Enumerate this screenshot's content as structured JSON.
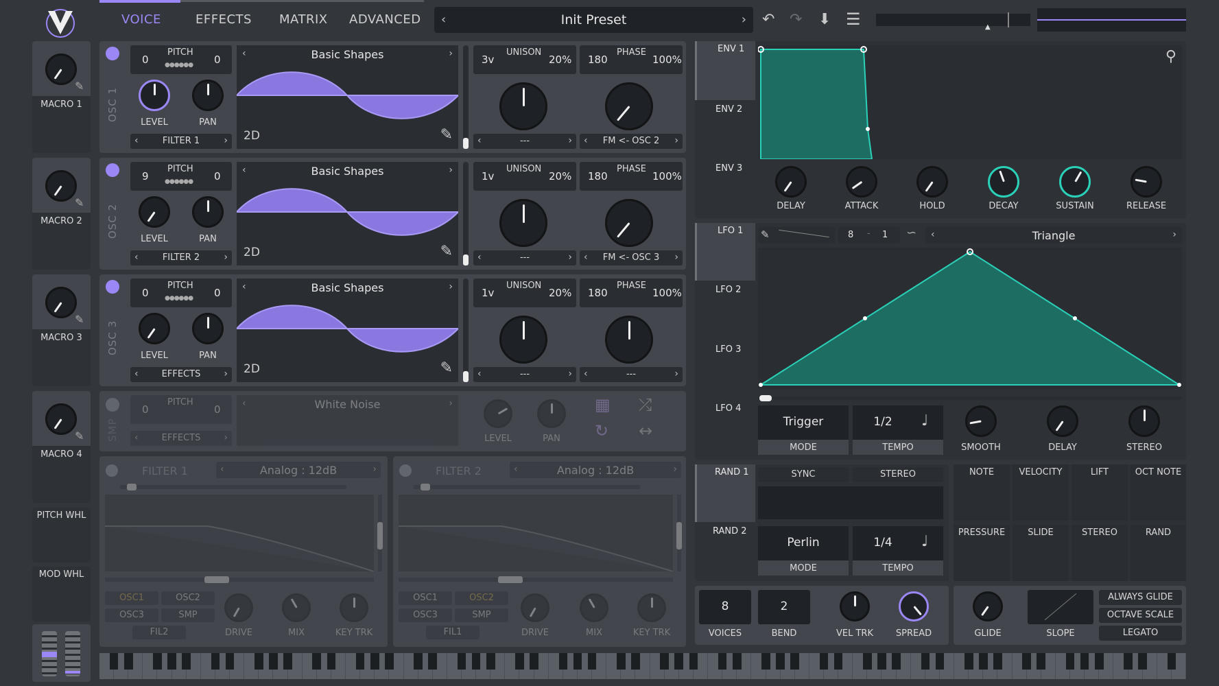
{
  "nav": {
    "tabs": [
      "VOICE",
      "EFFECTS",
      "MATRIX",
      "ADVANCED"
    ],
    "active": "VOICE"
  },
  "preset": {
    "name": "Init Preset"
  },
  "colors": {
    "accent": "#9b87f5",
    "teal": "#2ad1b8",
    "bg": "#33373c"
  },
  "macros": [
    {
      "label": "MACRO 1"
    },
    {
      "label": "MACRO 2"
    },
    {
      "label": "MACRO 3"
    },
    {
      "label": "MACRO 4"
    }
  ],
  "wheels": {
    "pitch": "PITCH WHL",
    "mod": "MOD WHL"
  },
  "osc": [
    {
      "name": "OSC 1",
      "pitch_left": "0",
      "pitch_right": "0",
      "pitch_label": "PITCH",
      "level": "LEVEL",
      "pan": "PAN",
      "dest": "FILTER 1",
      "wave": "Basic Shapes",
      "mode": "2D",
      "unison_v": "3v",
      "unison_label": "UNISON",
      "unison_pct": "20%",
      "phase_val": "180",
      "phase_label": "PHASE",
      "phase_pct": "100%",
      "unison_dest": "---",
      "phase_dest": "FM <- OSC 2"
    },
    {
      "name": "OSC 2",
      "pitch_left": "9",
      "pitch_right": "0",
      "pitch_label": "PITCH",
      "level": "LEVEL",
      "pan": "PAN",
      "dest": "FILTER 2",
      "wave": "Basic Shapes",
      "mode": "2D",
      "unison_v": "1v",
      "unison_label": "UNISON",
      "unison_pct": "20%",
      "phase_val": "180",
      "phase_label": "PHASE",
      "phase_pct": "100%",
      "unison_dest": "---",
      "phase_dest": "FM <- OSC 3"
    },
    {
      "name": "OSC 3",
      "pitch_left": "0",
      "pitch_right": "0",
      "pitch_label": "PITCH",
      "level": "LEVEL",
      "pan": "PAN",
      "dest": "EFFECTS",
      "wave": "Basic Shapes",
      "mode": "2D",
      "unison_v": "1v",
      "unison_label": "UNISON",
      "unison_pct": "20%",
      "phase_val": "180",
      "phase_label": "PHASE",
      "phase_pct": "100%",
      "unison_dest": "---",
      "phase_dest": "---"
    }
  ],
  "smp": {
    "name": "SMP",
    "pitch_left": "0",
    "pitch_right": "0",
    "pitch_label": "PITCH",
    "source": "White Noise",
    "dest": "EFFECTS",
    "level": "LEVEL",
    "pan": "PAN"
  },
  "filters": [
    {
      "name": "FILTER 1",
      "type": "Analog : 12dB",
      "routes": [
        "OSC1",
        "OSC2",
        "OSC3",
        "SMP",
        "FIL2"
      ],
      "knobs": [
        "DRIVE",
        "MIX",
        "KEY TRK"
      ]
    },
    {
      "name": "FILTER 2",
      "type": "Analog : 12dB",
      "routes": [
        "OSC1",
        "OSC2",
        "OSC3",
        "SMP",
        "FIL1"
      ],
      "knobs": [
        "DRIVE",
        "MIX",
        "KEY TRK"
      ]
    }
  ],
  "env": {
    "tabs": [
      "ENV 1",
      "ENV 2",
      "ENV 3"
    ],
    "knobs": [
      "DELAY",
      "ATTACK",
      "HOLD",
      "DECAY",
      "SUSTAIN",
      "RELEASE"
    ]
  },
  "lfo": {
    "tabs": [
      "LFO 1",
      "LFO 2",
      "LFO 3",
      "LFO 4"
    ],
    "beats": "8",
    "sub": "1",
    "shape": "Triangle",
    "mode_val": "Trigger",
    "mode_label": "MODE",
    "tempo_val": "1/2",
    "tempo_label": "TEMPO",
    "knobs": [
      "SMOOTH",
      "DELAY",
      "STEREO"
    ]
  },
  "rand": {
    "tabs": [
      "RAND 1",
      "RAND 2"
    ],
    "sync": "SYNC",
    "stereo": "STEREO",
    "mode_val": "Perlin",
    "mode_label": "MODE",
    "tempo_val": "1/4",
    "tempo_label": "TEMPO"
  },
  "mod_sources": [
    "NOTE",
    "VELOCITY",
    "LIFT",
    "OCT NOTE",
    "PRESSURE",
    "SLIDE",
    "STEREO",
    "RAND"
  ],
  "voice": {
    "voices_val": "8",
    "voices_label": "VOICES",
    "bend_val": "2",
    "bend_label": "BEND",
    "veltrk_label": "VEL TRK",
    "spread_label": "SPREAD",
    "glide_label": "GLIDE",
    "slope_label": "SLOPE",
    "always_glide": "ALWAYS GLIDE",
    "octave_scale": "OCTAVE SCALE",
    "legato": "LEGATO"
  }
}
